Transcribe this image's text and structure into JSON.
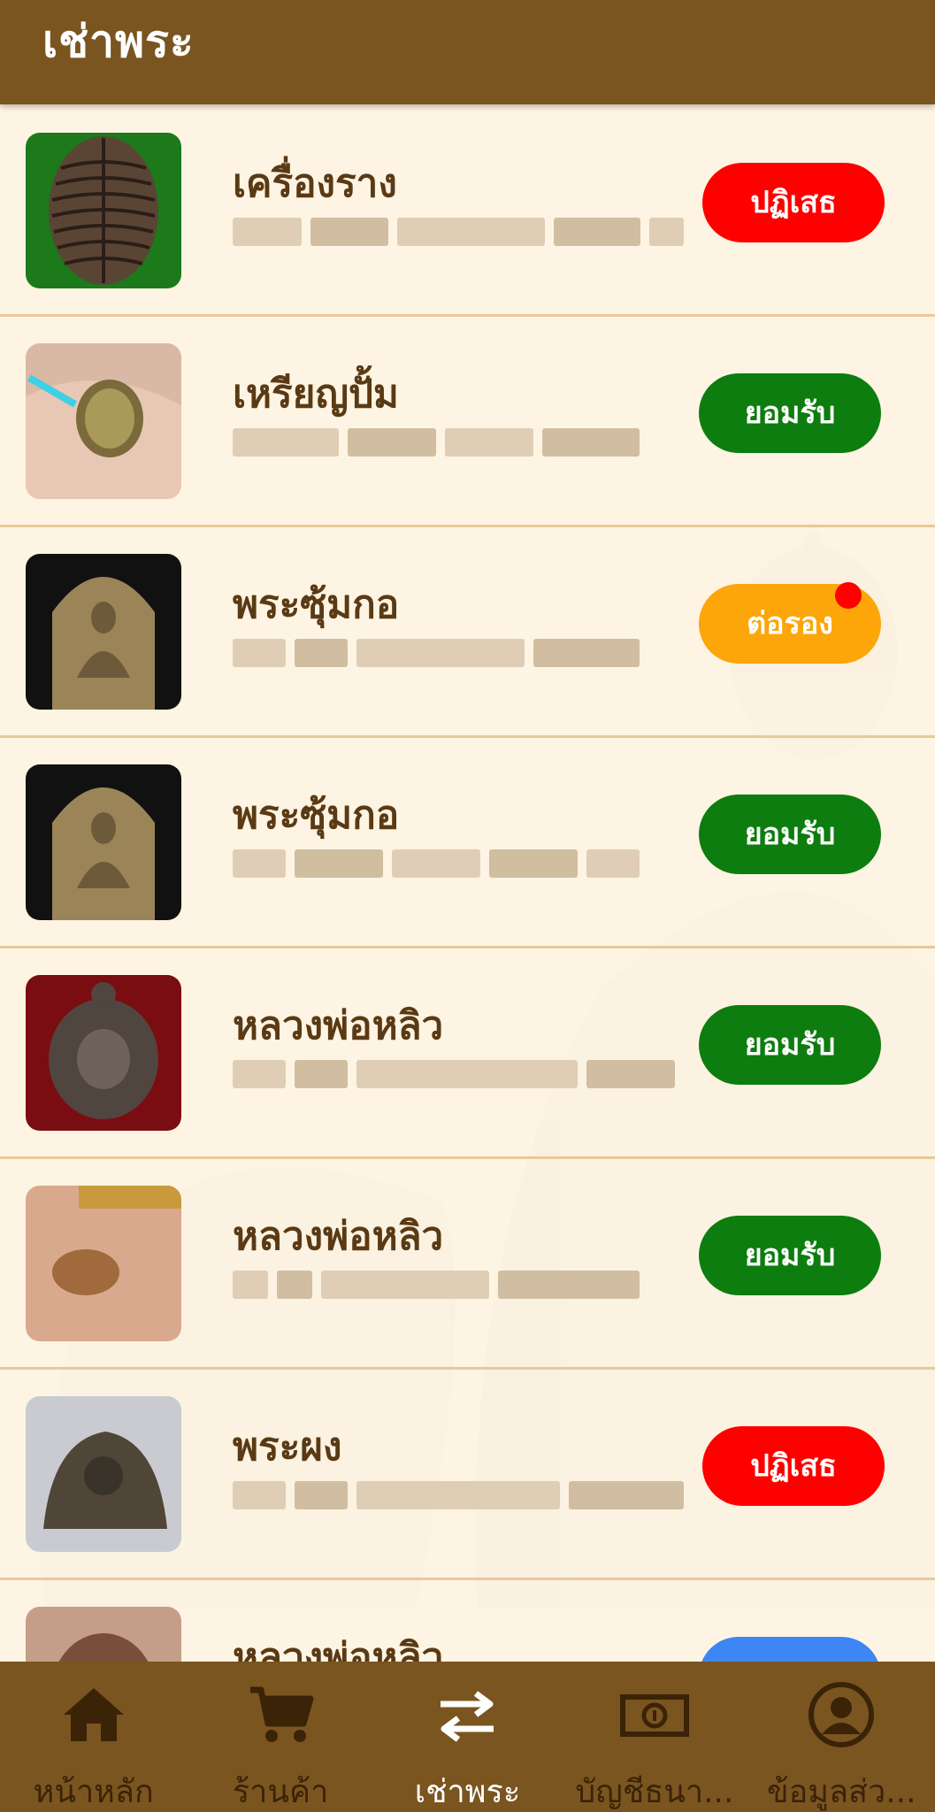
{
  "header": {
    "title": "เช่าพระ"
  },
  "items": [
    {
      "title": "เครื่องราง",
      "status": "ปฏิเสธ",
      "status_type": "reject",
      "has_badge": false
    },
    {
      "title": "เหรียญปั้ม",
      "status": "ยอมรับ",
      "status_type": "accept",
      "has_badge": false
    },
    {
      "title": "พระซุ้มกอ",
      "status": "ต่อรอง",
      "status_type": "nego",
      "has_badge": true
    },
    {
      "title": "พระซุ้มกอ",
      "status": "ยอมรับ",
      "status_type": "accept",
      "has_badge": false
    },
    {
      "title": "หลวงพ่อหลิว",
      "status": "ยอมรับ",
      "status_type": "accept",
      "has_badge": false
    },
    {
      "title": "หลวงพ่อหลิว",
      "status": "ยอมรับ",
      "status_type": "accept",
      "has_badge": false
    },
    {
      "title": "พระผง",
      "status": "ปฏิเสธ",
      "status_type": "reject",
      "has_badge": false
    },
    {
      "title": "หลวงพ่อหลิว",
      "status": "",
      "status_type": "pending",
      "has_badge": false
    }
  ],
  "nav": {
    "home": "หน้าหลัก",
    "shop": "ร้านค้า",
    "rent": "เช่าพระ",
    "account": "บัญชีธนา...",
    "profile": "ข้อมูลส่ว..."
  },
  "colors": {
    "header": "#7a5520",
    "background": "#fdf4e3",
    "reject": "#ff0000",
    "accept": "#0c7d0e",
    "negotiate": "#fca60a",
    "pending": "#3d86f4"
  }
}
